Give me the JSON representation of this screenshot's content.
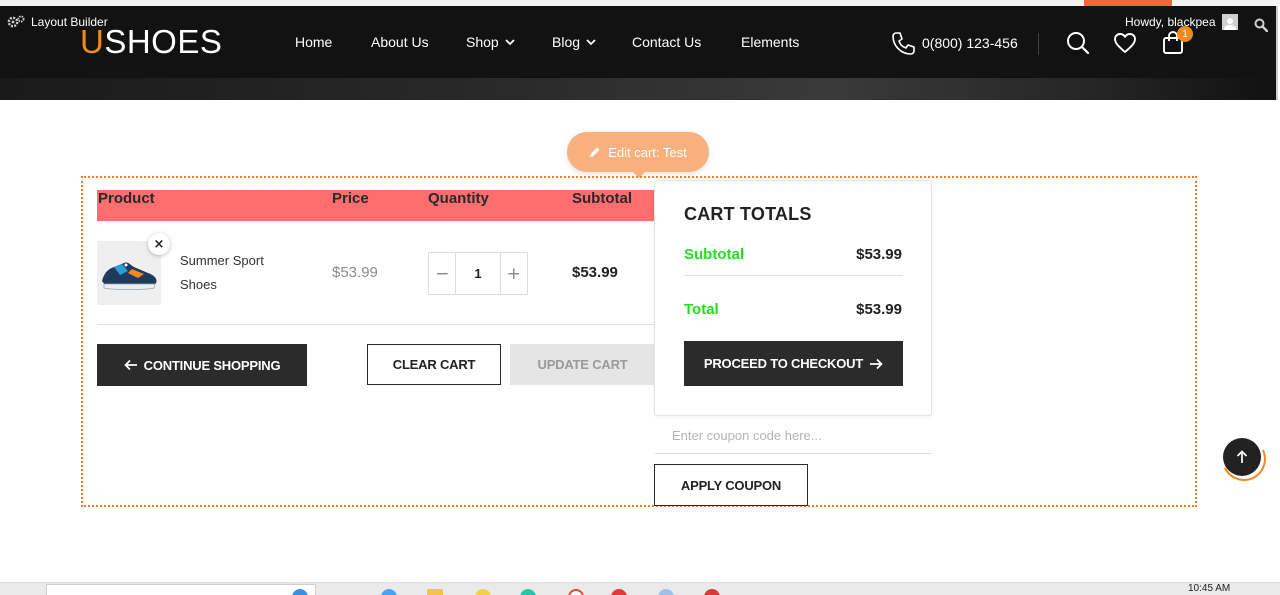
{
  "admin_bar": {
    "layout_builder": "Layout Builder",
    "howdy": "Howdy, blackpea"
  },
  "logo": {
    "u": "U",
    "rest": "SHOES"
  },
  "nav": {
    "items": [
      {
        "label": "Home"
      },
      {
        "label": "About Us"
      },
      {
        "label": "Shop"
      },
      {
        "label": "Blog"
      },
      {
        "label": "Contact Us"
      },
      {
        "label": "Elements"
      }
    ],
    "phone": "0(800) 123-456",
    "cart_count": "1"
  },
  "edit_pill": {
    "label": "Edit cart: Test"
  },
  "cart_table": {
    "headers": {
      "product": "Product",
      "price": "Price",
      "quantity": "Quantity",
      "subtotal": "Subtotal"
    },
    "row": {
      "name": "Summer Sport Shoes",
      "price": "$53.99",
      "quantity": "1",
      "subtotal": "$53.99",
      "remove": "×",
      "minus": "−",
      "plus": "+"
    }
  },
  "buttons": {
    "continue": "CONTINUE SHOPPING",
    "clear": "CLEAR CART",
    "update": "UPDATE CART",
    "checkout": "PROCEED TO CHECKOUT",
    "apply_coupon": "APPLY COUPON"
  },
  "totals": {
    "title": "CART TOTALS",
    "subtotal_label": "Subtotal",
    "subtotal_value": "$53.99",
    "total_label": "Total",
    "total_value": "$53.99"
  },
  "coupon": {
    "placeholder": "Enter coupon code here..."
  },
  "taskbar": {
    "time": "10:45 AM"
  },
  "colors": {
    "accent": "#f08a1c",
    "table_header": "#ff6e6e",
    "totals_label": "#20e020",
    "dark_button": "#2b2b2b"
  }
}
